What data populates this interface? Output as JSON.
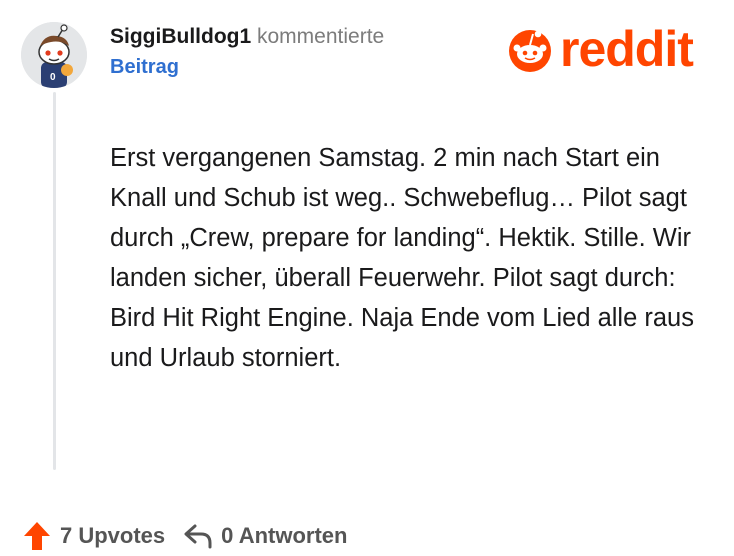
{
  "author": {
    "username": "SiggiBulldog1",
    "action": "kommentierte",
    "target_link": "Beitrag"
  },
  "brand": {
    "wordmark": "reddit",
    "accent": "#ff4500"
  },
  "comment": {
    "text": "Erst vergangenen Samstag. 2 min nach Start ein Knall und Schub ist weg.. Schwebeflug… Pilot sagt durch „Crew, prepare for landing“. Hektik. Stille. Wir landen sicher, überall Feuerwehr. Pilot sagt durch: Bird Hit Right Engine. Naja Ende vom Lied alle raus und Urlaub storniert."
  },
  "footer": {
    "upvotes": "7 Upvotes",
    "replies": "0 Antworten",
    "upvote_icon": "upvote-arrow-icon",
    "reply_icon": "reply-arrow-icon"
  },
  "colors": {
    "link": "#2f6fd0",
    "upvote": "#ff4500",
    "thread_line": "#e3e5e8"
  }
}
